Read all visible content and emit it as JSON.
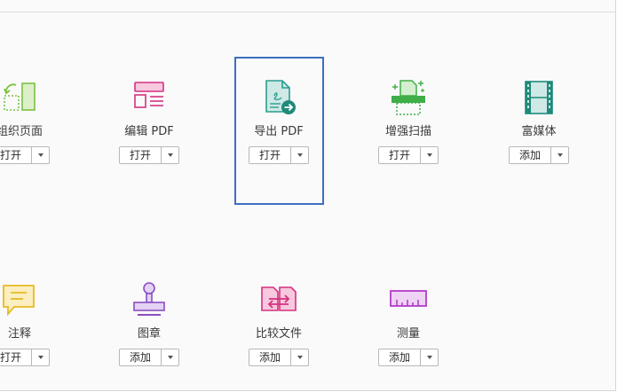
{
  "tools": {
    "organize": {
      "label": "组织页面",
      "button": "打开"
    },
    "edit": {
      "label": "编辑 PDF",
      "button": "打开"
    },
    "export": {
      "label": "导出 PDF",
      "button": "打开"
    },
    "enhance": {
      "label": "增强扫描",
      "button": "打开"
    },
    "richmedia": {
      "label": "富媒体",
      "button": "添加"
    },
    "comment": {
      "label": "注释",
      "button": "打开"
    },
    "stamp": {
      "label": "图章",
      "button": "添加"
    },
    "compare": {
      "label": "比较文件",
      "button": "添加"
    },
    "measure": {
      "label": "测量",
      "button": "添加"
    }
  },
  "icons": {
    "organize": "organize-pages-icon",
    "edit": "edit-pdf-icon",
    "export": "export-pdf-icon",
    "enhance": "enhance-scans-icon",
    "richmedia": "rich-media-icon",
    "comment": "comment-icon",
    "stamp": "stamp-icon",
    "compare": "compare-files-icon",
    "measure": "measure-icon"
  },
  "colors": {
    "selection": "#3c6fc0",
    "organize": "#7ac143",
    "edit": "#d4317f",
    "export": "#2a9d8f",
    "enhance": "#3fae49",
    "richmedia": "#1f8a7a",
    "comment": "#e8b923",
    "stamp": "#8a4fc2",
    "compare": "#d4317f",
    "measure": "#b23ec8"
  }
}
